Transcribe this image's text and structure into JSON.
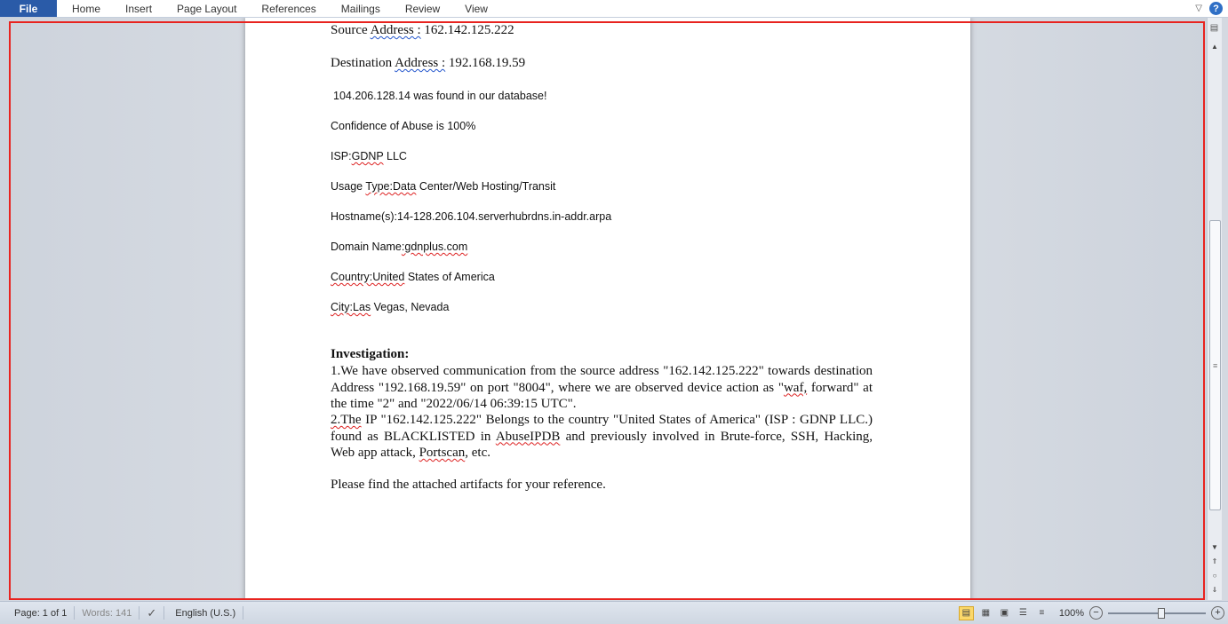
{
  "ribbon": {
    "file_label": "File",
    "tabs": [
      "Home",
      "Insert",
      "Page Layout",
      "References",
      "Mailings",
      "Review",
      "View"
    ],
    "help_label": "?"
  },
  "document": {
    "lines": {
      "source_label": "Source",
      "source_address_word": "Address :",
      "source_value": "162.142.125.222",
      "dest_label": "Destination",
      "dest_address_word": "Address :",
      "dest_value": "192.168.19.59",
      "found_text": "104.206.128.14   was found in our database!",
      "confidence_text": "Confidence of Abuse is  100%",
      "isp_label": "ISP:",
      "isp_value": "GDNP",
      "isp_suffix": " LLC",
      "usage_label": "Usage ",
      "usage_word": "Type:Data",
      "usage_rest": " Center/Web Hosting/Transit",
      "hostname_text": "Hostname(s):14-128.206.104.serverhubrdns.in-addr.arpa",
      "domain_label": "Domain Name",
      "domain_value": ":gdnplus.com",
      "country_word": "Country:United",
      "country_rest": " States of America",
      "city_word": "City:Las",
      "city_rest": " Vegas, Nevada"
    },
    "investigation_heading": "Investigation:",
    "para1": {
      "a": "1.We have observed communication  from the source address \"162.142.125.222\" towards destination Address \"192.168.19.59\" on port \"8004\", where we are observed device action as \"",
      "b": "waf,",
      "c": " forward\" at the time \"2\" and \"2022/06/14  06:39:15 UTC\"."
    },
    "para2": {
      "a": "2.The",
      "b": " IP \"162.142.125.222\" Belongs to the country \"United States of America\"  (ISP : GDNP LLC.) found as BLACKLISTED in ",
      "c": "AbuseIPDB",
      "d": " and previously involved in Brute-force, SSH, Hacking, Web app attack, ",
      "e": "Portscan",
      "f": ", etc."
    },
    "closing": "Please  find the attached artifacts for your reference."
  },
  "statusbar": {
    "page": "Page: 1 of 1",
    "words": "Words: 141",
    "language": "English (U.S.)",
    "zoom": "100%",
    "zoom_fraction": 0.55
  },
  "icons": [
    "minimize-ribbon-icon",
    "help-icon",
    "proofing-icon",
    "print-layout-icon",
    "full-screen-reading-icon",
    "web-layout-icon",
    "outline-icon",
    "draft-icon",
    "zoom-out-icon",
    "zoom-in-icon"
  ]
}
